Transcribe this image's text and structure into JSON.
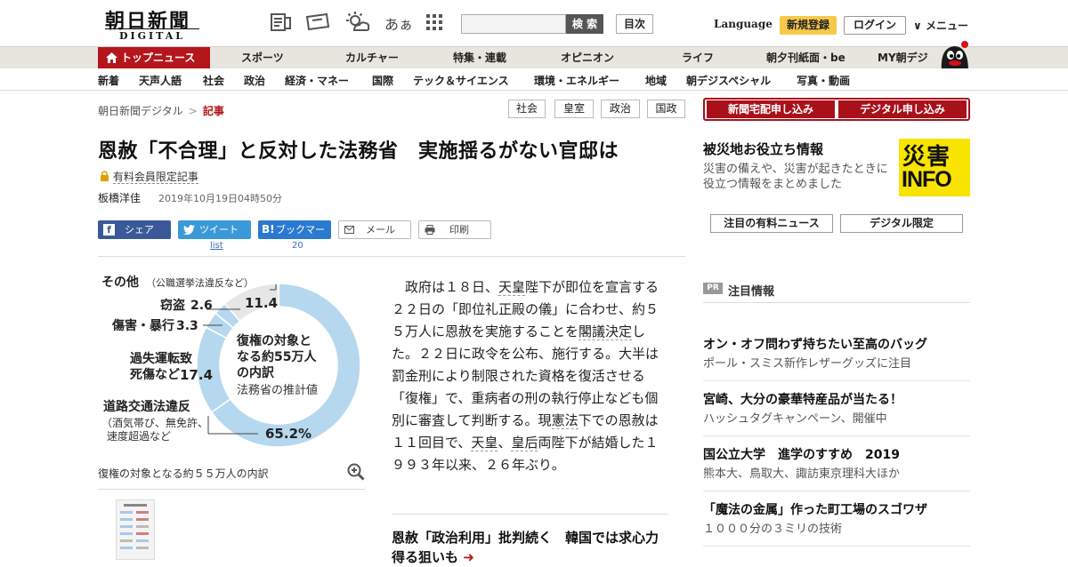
{
  "header": {
    "logo_main": "朝日新聞",
    "logo_sub": "DIGITAL",
    "search_button": "検 索",
    "search_placeholder": "",
    "toc_button": "目次",
    "icon_text": "あぁ",
    "language": "Language",
    "register": "新規登録",
    "login": "ログイン",
    "menu": "メニュー"
  },
  "main_nav": [
    "トップニュース",
    "スポーツ",
    "カルチャー",
    "特集・連載",
    "オピニオン",
    "ライフ",
    "朝夕刊紙面・be",
    "MY朝デジ"
  ],
  "sub_nav": [
    "新着",
    "天声人語",
    "社会",
    "政治",
    "経済・マネー",
    "国際",
    "テック＆サイエンス",
    "環境・エネルギー",
    "地域",
    "朝デジスペシャル",
    "写真・動画"
  ],
  "breadcrumb": {
    "home": "朝日新聞デジタル",
    "sep": ">",
    "current": "記事"
  },
  "tags": [
    "社会",
    "皇室",
    "政治",
    "国政"
  ],
  "promo_buttons": [
    "新聞宅配申し込み",
    "デジタル申し込み"
  ],
  "article": {
    "title": "恩赦「不合理」と反対した法務省　実施揺るがない官邸は",
    "members_only": "有料会員限定記事",
    "author": "板橋洋佳",
    "date": "2019年10月19日04時50分",
    "share": {
      "facebook": "シェア",
      "twitter": "ツイート",
      "twitter_count": "list",
      "hatena": "ブックマーク",
      "hatena_count": "20",
      "mail": "メール",
      "print": "印刷"
    },
    "body_segments": [
      {
        "t": "　政府は１８日、",
        "k": false
      },
      {
        "t": "天皇",
        "k": true
      },
      {
        "t": "陛下が即位を宣言する２２日の「即位礼正殿の儀」に合わせ、約５５万人に恩赦を実施することを",
        "k": false
      },
      {
        "t": "閣議決定",
        "k": true
      },
      {
        "t": "した。２２日に政令を公布、施行する。大半は罰金刑により制限された資格を復活させる「復権」で、重病者の刑の執行停止なども個別に審査して判断する。現",
        "k": false
      },
      {
        "t": "憲法",
        "k": true
      },
      {
        "t": "下での恩赦は１１回目で、",
        "k": false
      },
      {
        "t": "天皇",
        "k": true
      },
      {
        "t": "、",
        "k": false
      },
      {
        "t": "皇后",
        "k": true
      },
      {
        "t": "両陛下が結婚した１９９３年以来、２６年ぶり。",
        "k": false
      }
    ],
    "related": "恩赦「政治利用」批判続く　韓国では求心力得る狙いも"
  },
  "chart_data": {
    "type": "pie",
    "title": "復権の対象となる約55万人の内訳",
    "subtitle": "法務省の推計値",
    "categories": [
      "道路交通法違反（酒気帯び、無免許、速度超過など）",
      "過失運転致死傷など",
      "傷害・暴行",
      "窃盗",
      "その他（公職選挙法違反など）"
    ],
    "labels": [
      {
        "main": "道路交通法違反",
        "sub1": "（酒気帯び、無免許、",
        "sub2": "速度超過など",
        "value": "65.2%"
      },
      {
        "main1": "過失運転致",
        "main2": "死傷など",
        "value": "17.4"
      },
      {
        "main": "傷害・暴行",
        "value": "3.3"
      },
      {
        "main": "窃盗",
        "value": "2.6"
      },
      {
        "main": "その他",
        "sub": "（公職選挙法違反など）",
        "value": "11.4"
      }
    ],
    "values": [
      65.2,
      17.4,
      3.3,
      2.6,
      11.4
    ],
    "colors": [
      "#b6d8ee",
      "#b6d8ee",
      "#b6d8ee",
      "#b6d8ee",
      "#e6e6e6"
    ],
    "center_lines": [
      "復権の対象と",
      "なる約55万人",
      "の内訳"
    ]
  },
  "chart_caption": "復権の対象となる約５５万人の内訳",
  "right": {
    "disaster_title": "被災地お役立ち情報",
    "disaster_desc": "災害の備えや、災害が起きたときに役立つ情報をまとめました",
    "disaster_logo_top": "災害",
    "disaster_logo_bottom": "INFO",
    "buttons": [
      "注目の有料ニュース",
      "デジタル限定"
    ],
    "pr_badge": "PR",
    "pr_label": "注目情報",
    "pr_items": [
      {
        "head": "オン・オフ問わず持ちたい至高のバッグ",
        "sub": "ポール・スミス新作レザーグッズに注目"
      },
      {
        "head": "宮崎、大分の豪華特産品が当たる！",
        "sub": "ハッシュタグキャンペーン、開催中"
      },
      {
        "head": "国公立大学　進学のすすめ　2019",
        "sub": "熊本大、鳥取大、諏訪東京理科大ほか"
      },
      {
        "head": "「魔法の金属」作った町工場のスゴワザ",
        "sub": "１０００分の３ミリの技術"
      }
    ]
  }
}
